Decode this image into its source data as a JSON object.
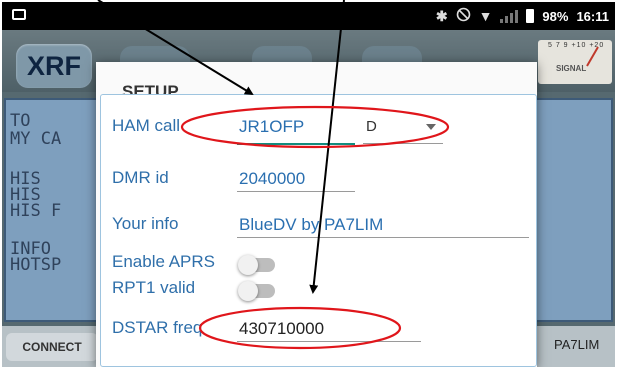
{
  "status_bar": {
    "icons": [
      "gallery-icon",
      "bluetooth-icon",
      "do-not-disturb-icon",
      "wifi-icon",
      "signal-icon",
      "battery-icon"
    ],
    "bluetooth_glyph": "✱",
    "dnd_glyph": "⃠",
    "wifi_glyph": "▼",
    "battery_percent": "98%",
    "time": "16:11"
  },
  "app": {
    "mode_button": "XRF",
    "signal_meter_label": "SIGNAL",
    "signal_scale": "5 7 9 +10 +20",
    "display_lines": [
      "TO",
      "MY CA",
      "",
      "HIS ",
      "HIS ",
      "HIS F",
      "INFO",
      "HOTSP"
    ],
    "connect_button": "CONNECT",
    "bottom_call": "PA7LIM"
  },
  "dialog": {
    "title": "SETUP",
    "ham_call_label": "HAM call",
    "ham_call_value": "JR1OFP",
    "ham_call_suffix": "D",
    "dmr_id_label": "DMR id",
    "dmr_id_value": "2040000",
    "your_info_label": "Your info",
    "your_info_value": "BlueDV by PA7LIM",
    "enable_aprs_label": "Enable APRS",
    "enable_aprs_on": false,
    "rpt1_valid_label": "RPT1 valid",
    "rpt1_valid_on": false,
    "dstar_freq_label": "DSTAR freq",
    "dstar_freq_value": "430710000"
  },
  "colors": {
    "label_blue": "#2f6faa",
    "value_blue": "#2a6fb0",
    "annotation_red": "#e0161b",
    "annotation_black": "#000000"
  }
}
